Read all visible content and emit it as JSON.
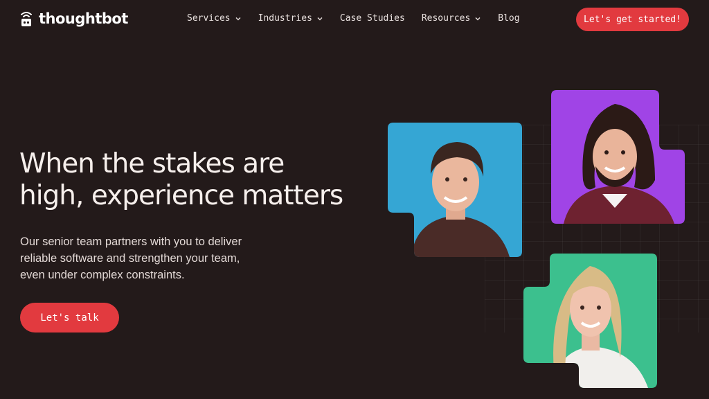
{
  "brand": {
    "name": "thoughtbot",
    "accent_color": "#e23a3f",
    "background_color": "#231a1a"
  },
  "nav": {
    "items": [
      {
        "label": "Services",
        "icon": "chevron-down-icon"
      },
      {
        "label": "Industries",
        "icon": "chevron-down-icon"
      },
      {
        "label": "Case Studies"
      },
      {
        "label": "Resources",
        "icon": "chevron-down-icon"
      },
      {
        "label": "Blog"
      }
    ],
    "cta_label": "Let's get started!"
  },
  "hero": {
    "title_lines": [
      "When the stakes are",
      "high, experience matters"
    ],
    "subtitle_lines": [
      "Our senior team partners with you to deliver",
      "reliable software and strengthen your team,",
      "even under complex constraints."
    ],
    "cta_label": "Let's talk"
  },
  "portraits": [
    {
      "name": "portrait-man-blue-background",
      "color": "#35a6d4"
    },
    {
      "name": "portrait-man-purple-background",
      "color": "#a044e6"
    },
    {
      "name": "portrait-woman-green-background",
      "color": "#3cc08e"
    }
  ]
}
